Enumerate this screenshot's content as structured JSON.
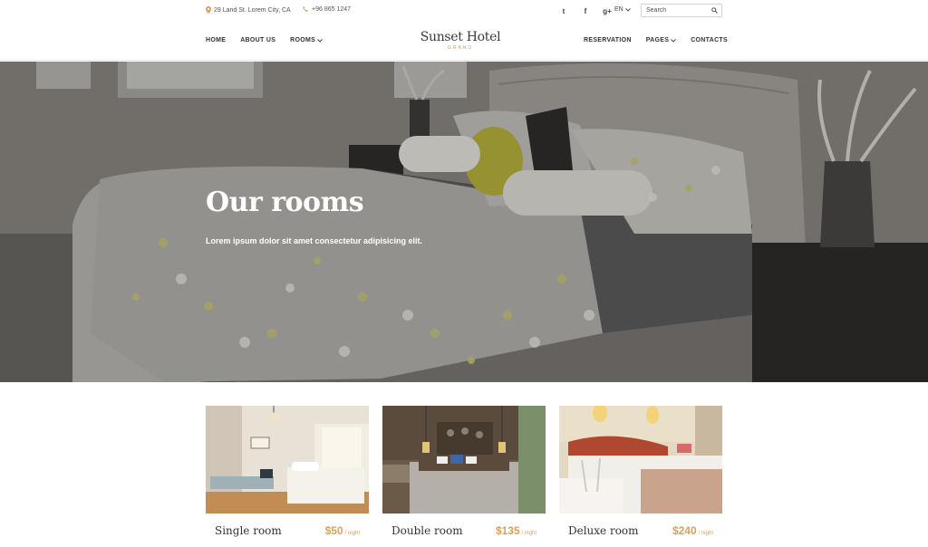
{
  "topbar": {
    "address": "29 Land St. Lorem City, CA",
    "phone": "+96 865 1247",
    "social": [
      {
        "icon": "twitter-icon",
        "glyph": "t"
      },
      {
        "icon": "facebook-icon",
        "glyph": "f"
      },
      {
        "icon": "google-plus-icon",
        "glyph": "g+"
      }
    ],
    "language": "EN",
    "search_placeholder": "Search"
  },
  "header": {
    "logo_name": "Sunset Hotel",
    "logo_sub": "GRAND",
    "nav_left": [
      "HOME",
      "ABOUT US",
      "ROOMS"
    ],
    "nav_right": [
      "RESERVATION",
      "PAGES",
      "CONTACTS"
    ]
  },
  "hero": {
    "title": "Our rooms",
    "subtitle": "Lorem ipsum dolor sit amet consectetur adipisicing elit."
  },
  "rooms": [
    {
      "name": "Single room",
      "price": "$50",
      "per": "/ night"
    },
    {
      "name": "Double room",
      "price": "$135",
      "per": "/ night"
    },
    {
      "name": "Deluxe room",
      "price": "$240",
      "per": "/ night"
    }
  ],
  "colors": {
    "accent": "#d9a05b",
    "logo_sub": "#c8a46d",
    "text": "#333333"
  }
}
